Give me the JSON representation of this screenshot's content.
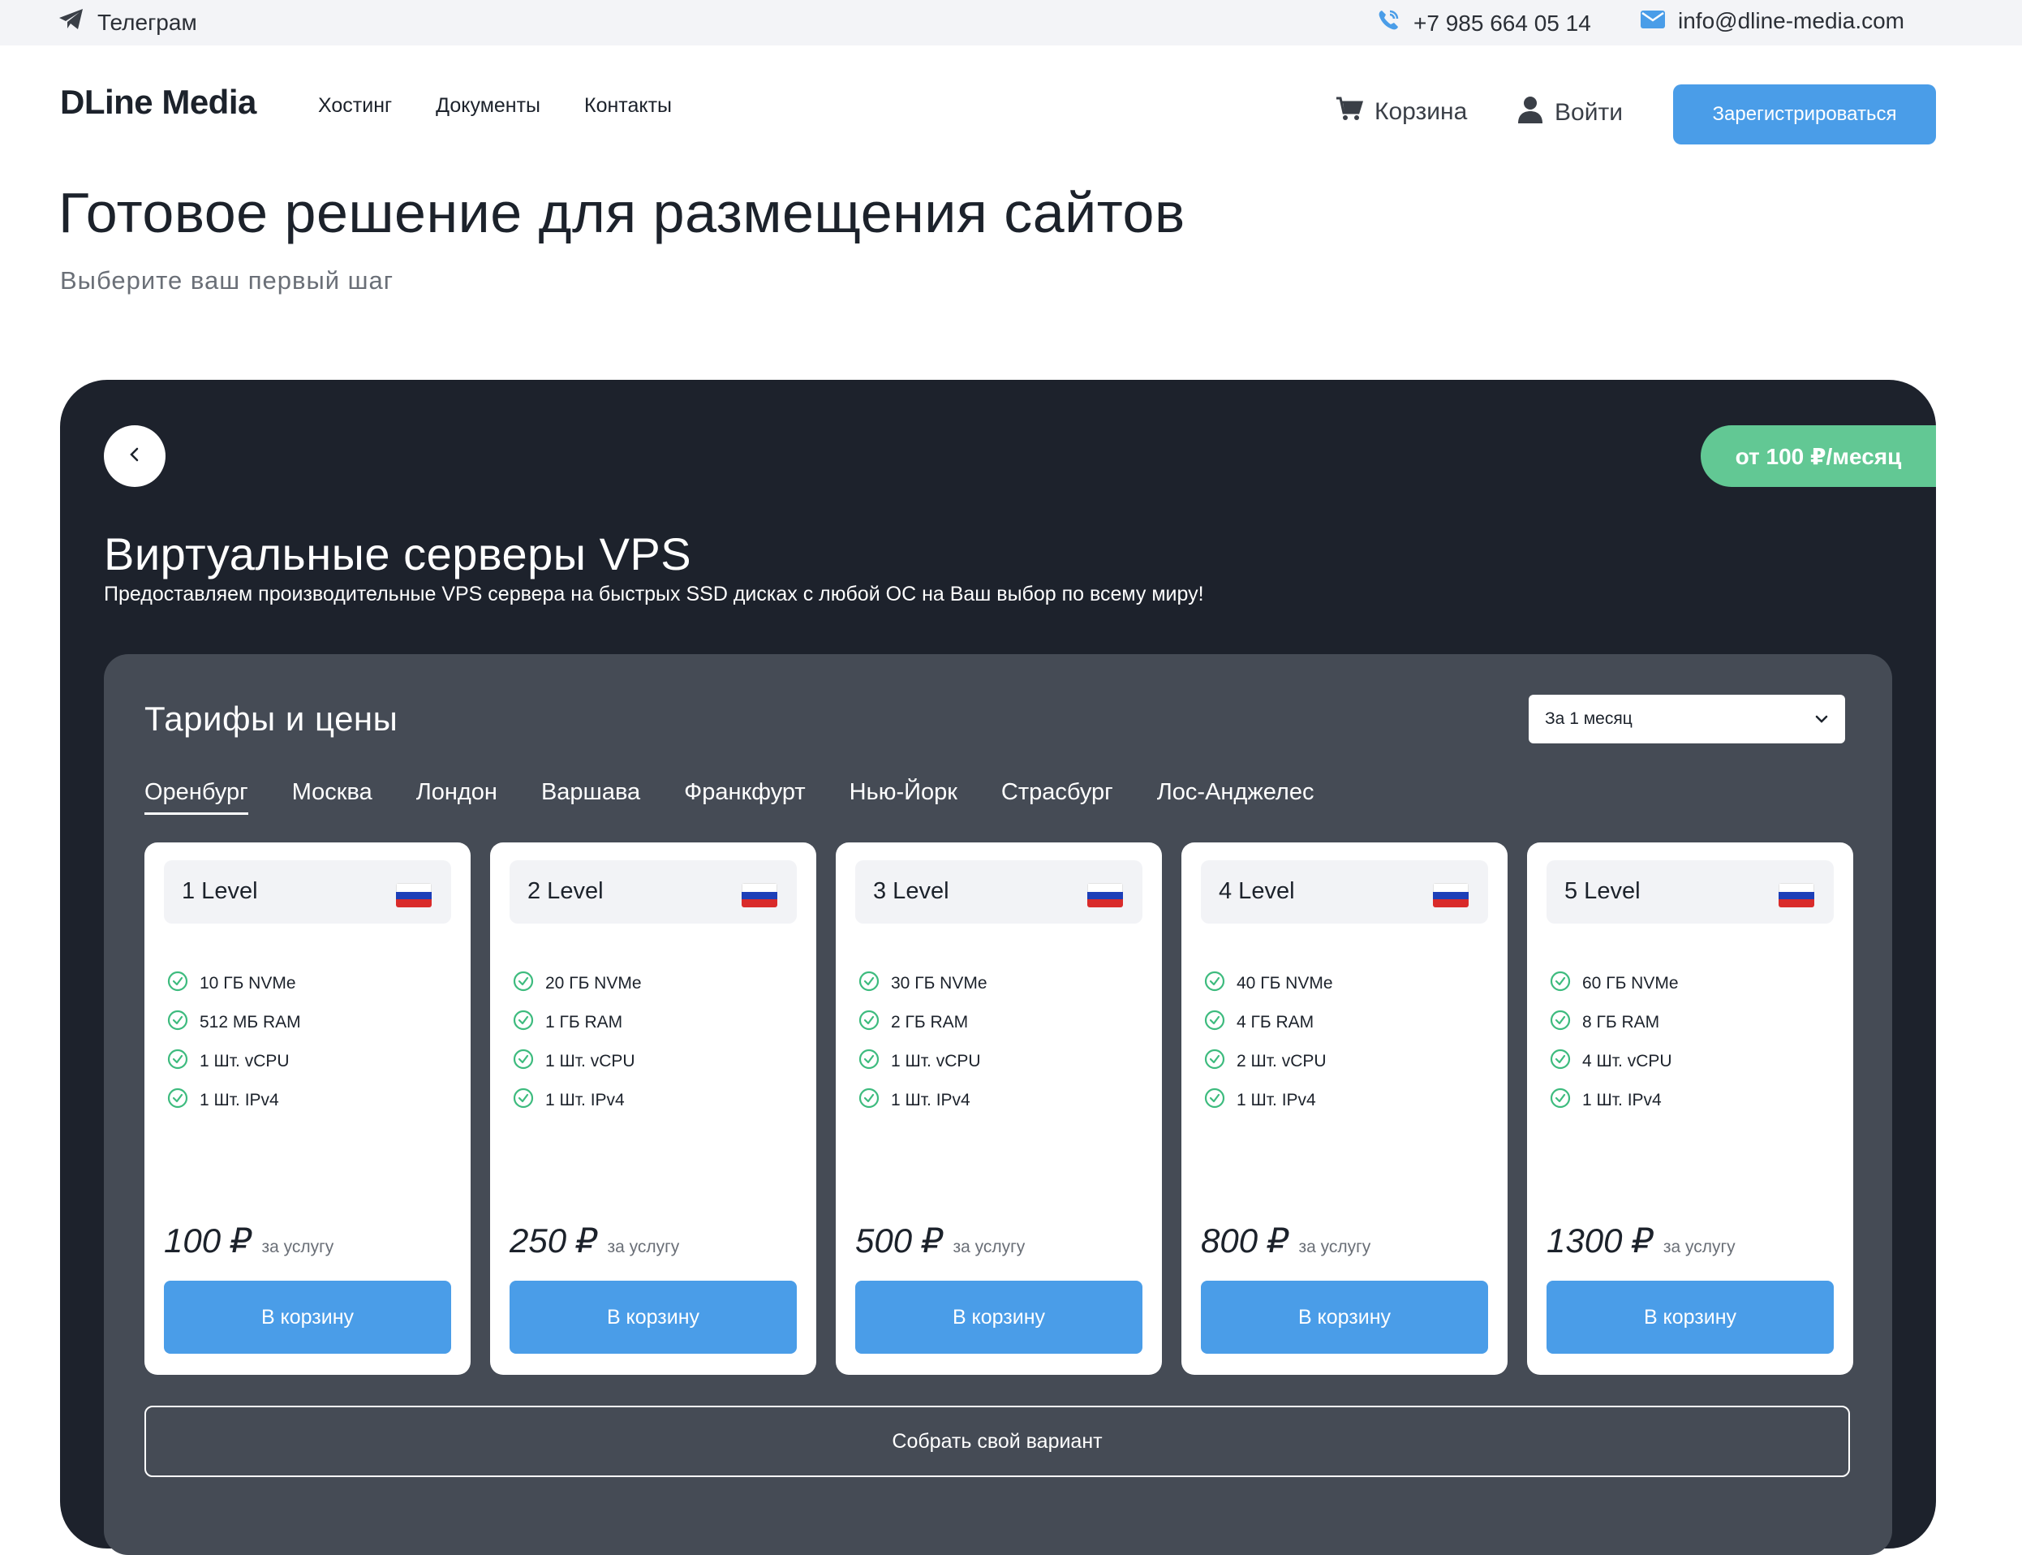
{
  "topbar": {
    "telegram": "Телеграм",
    "phone": "+7 985 664 05 14",
    "email": "info@dline-media.com"
  },
  "header": {
    "logo": "DLine Media",
    "nav": [
      "Хостинг",
      "Документы",
      "Контакты"
    ],
    "cart": "Корзина",
    "login": "Войти",
    "register": "Зарегистрироваться"
  },
  "hero": {
    "title": "Готовое решение для размещения сайтов",
    "subtitle": "Выберите ваш первый шаг"
  },
  "product": {
    "price_badge": "от 100 ₽/месяц",
    "title": "Виртуальные серверы VPS",
    "description": "Предоставляем производительные VPS сервера на быстрых SSD дисках с любой ОС на Ваш выбор по всему миру!"
  },
  "pricing": {
    "title": "Тарифы и цены",
    "period_selected": "За 1 месяц",
    "cities": [
      "Оренбург",
      "Москва",
      "Лондон",
      "Варшава",
      "Франкфурт",
      "Нью-Йорк",
      "Страсбург",
      "Лос-Анджелес"
    ],
    "active_city": "Оренбург",
    "per_label": "за услугу",
    "cart_button": "В корзину",
    "custom_button": "Собрать свой вариант",
    "plans": [
      {
        "name": "1 Level",
        "features": [
          "10 ГБ NVMe",
          "512 МБ RAM",
          "1 Шт. vCPU",
          "1 Шт. IPv4"
        ],
        "price": "100 ₽"
      },
      {
        "name": "2 Level",
        "features": [
          "20 ГБ NVMe",
          "1 ГБ RAM",
          "1 Шт. vCPU",
          "1 Шт. IPv4"
        ],
        "price": "250 ₽"
      },
      {
        "name": "3 Level",
        "features": [
          "30 ГБ NVMe",
          "2 ГБ RAM",
          "1 Шт. vCPU",
          "1 Шт. IPv4"
        ],
        "price": "500 ₽"
      },
      {
        "name": "4 Level",
        "features": [
          "40 ГБ NVMe",
          "4 ГБ RAM",
          "2 Шт. vCPU",
          "1 Шт. IPv4"
        ],
        "price": "800 ₽"
      },
      {
        "name": "5 Level",
        "features": [
          "60 ГБ NVMe",
          "8 ГБ RAM",
          "4 Шт. vCPU",
          "1 Шт. IPv4"
        ],
        "price": "1300 ₽"
      }
    ]
  },
  "colors": {
    "accent": "#4a9de8",
    "badge": "#62c894",
    "panel": "#1d222c",
    "pricebox": "#454b55",
    "check": "#3dbb7e"
  },
  "icons": {
    "telegram": "telegram-icon",
    "phone": "phone-icon",
    "email": "mail-icon",
    "cart": "cart-icon",
    "login": "user-icon",
    "back": "chevron-left-icon",
    "dropdown": "chevron-down-icon",
    "feature": "check-circle-icon",
    "flag": "russia-flag-icon"
  }
}
